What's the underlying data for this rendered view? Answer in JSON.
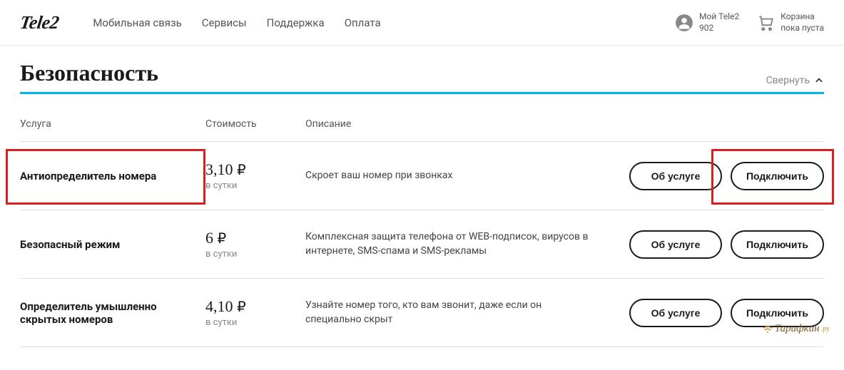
{
  "header": {
    "logo": "Tele2",
    "nav": [
      "Мобильная связь",
      "Сервисы",
      "Поддержка",
      "Оплата"
    ],
    "account": {
      "label": "Мой Tele2",
      "sub": "902"
    },
    "cart": {
      "label": "Корзина",
      "sub": "пока пуста"
    }
  },
  "section": {
    "title": "Безопасность",
    "collapse": "Свернуть"
  },
  "columns": {
    "service": "Услуга",
    "price": "Стоимость",
    "desc": "Описание"
  },
  "actions": {
    "about": "Об услуге",
    "connect": "Подключить"
  },
  "period": "в сутки",
  "currency": "₽",
  "rows": [
    {
      "name": "Антиопределитель номера",
      "price": "3,10",
      "desc": "Скроет ваш номер при звонках",
      "highlighted": true
    },
    {
      "name": "Безопасный режим",
      "price": "6",
      "desc": "Комплексная защита телефона от WEB-подписок, вирусов в интернете, SMS-спама и SMS-рекламы",
      "highlighted": false
    },
    {
      "name": "Определитель умышленно скрытых номеров",
      "price": "4,10",
      "desc": "Узнайте номер того, кто вам звонит, даже если он специально скрыт",
      "highlighted": false
    }
  ],
  "watermark": {
    "text": "Тарифкин",
    "suffix": ".ру"
  }
}
